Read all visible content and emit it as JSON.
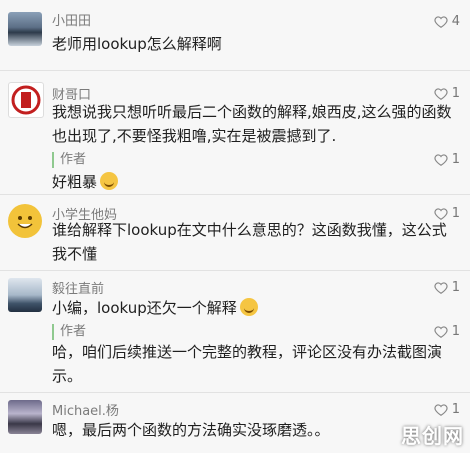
{
  "comments": [
    {
      "author": "小田田",
      "likes": "4",
      "text": "老师用lookup怎么解释啊"
    },
    {
      "author": "财哥口",
      "likes": "1",
      "text": "我想说我只想听听最后二个函数的解释,娘西皮,这么强的函数也出现了,不要怪我粗噜,实在是被震撼到了."
    },
    {
      "reply_tag": "作者",
      "likes": "1",
      "text": "好粗暴"
    },
    {
      "author": "小学生他妈",
      "likes": "1",
      "text": "谁给解释下lookup在文中什么意思的？这函数我懂，这公式我不懂"
    },
    {
      "author": "毅往直前",
      "likes": "1",
      "text": "小编，lookup还欠一个解释"
    },
    {
      "reply_tag": "作者",
      "likes": "1",
      "text": "哈，咱们后续推送一个完整的教程，评论区没有办法截图演示。"
    },
    {
      "author": "Michael.杨",
      "likes": "1",
      "text": "嗯，最后两个函数的方法确实没琢磨透。。"
    }
  ],
  "watermark": "思创网",
  "icons": {
    "like": "heart-outline-icon"
  },
  "colors": {
    "reply_bar": "#8fc98f",
    "author_text": "#7b7b7b"
  }
}
